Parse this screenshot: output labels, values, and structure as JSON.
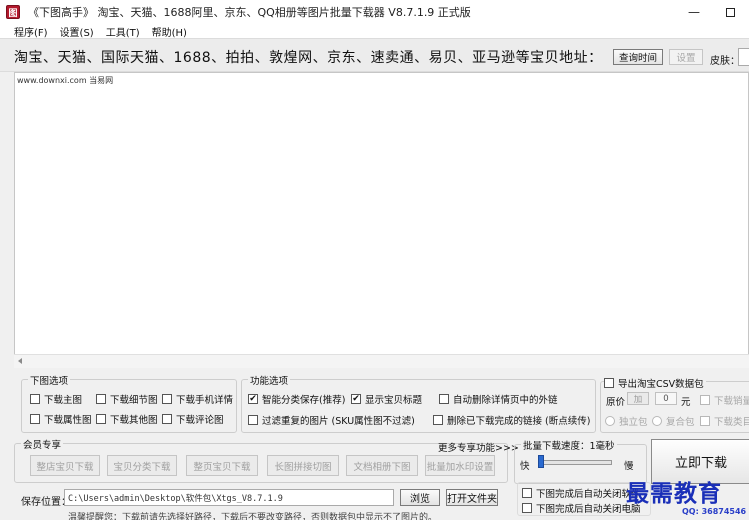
{
  "window": {
    "icon_glyph": "图",
    "title": "《下图高手》 淘宝、天猫、1688阿里、京东、QQ相册等图片批量下载器 V8.7.1.9 正式版",
    "min_glyph": "—",
    "icon": "app-logo-icon"
  },
  "menu": [
    "程序(F)",
    "设置(S)",
    "工具(T)",
    "帮助(H)"
  ],
  "url_bar": {
    "label": "淘宝、天猫、国际天猫、1688、拍拍、敦煌网、京东、速卖通、易贝、亚马逊等宝贝地址：",
    "query_time_button": "查询时间",
    "settings_button": "设置",
    "skin_label": "皮肤："
  },
  "text_area": {
    "content": "www.downxi.com 当易网"
  },
  "download_options": {
    "title": "下图选项",
    "items": [
      {
        "label": "下载主图",
        "checked": false
      },
      {
        "label": "下载细节图",
        "checked": false
      },
      {
        "label": "下载手机详情",
        "checked": false
      },
      {
        "label": "下载属性图",
        "checked": false
      },
      {
        "label": "下载其他图",
        "checked": false
      },
      {
        "label": "下载评论图",
        "checked": false
      }
    ]
  },
  "function_options": {
    "title": "功能选项",
    "items": [
      {
        "label": "智能分类保存(推荐)",
        "checked": true
      },
      {
        "label": "显示宝贝标题",
        "checked": true
      },
      {
        "label": "自动删除详情页中的外链",
        "checked": false
      },
      {
        "label": "过滤重复的图片 (SKU属性图不过滤)",
        "checked": false
      },
      {
        "label": "删除已下载完成的链接 (断点续传)",
        "checked": false
      }
    ]
  },
  "csv_export": {
    "title": "导出淘宝CSV数据包",
    "price_label": "原价",
    "price_op": "加",
    "price_value": "0",
    "price_unit": "元",
    "download_sales": "下载销量",
    "radio_independent": "独立包",
    "radio_merged": "复合包",
    "download_category": "下载类目"
  },
  "member": {
    "title": "会员专享",
    "more_link": "更多专享功能>>>",
    "buttons": [
      "整店宝贝下载",
      "宝贝分类下载",
      "整页宝贝下载",
      "长图拼接切图",
      "文档相册下图",
      "批量加水印设置"
    ]
  },
  "batch": {
    "speed_label": "批量下载速度：1毫秒",
    "fast": "快",
    "slow": "慢",
    "close_app_after": "下图完成后自动关闭软件",
    "shutdown_after": "下图完成后自动关闭电脑"
  },
  "download_button": "立即下载",
  "save": {
    "label": "保存位置：",
    "path": "C:\\Users\\admin\\Desktop\\软件包\\Xtgs_V8.7.1.9",
    "browse_button": "浏览",
    "open_folder_button": "打开文件夹",
    "tip": "温馨提醒您：下载前请先选择好路径，下载后不要改变路径，否则数据包中显示不了图片的。"
  },
  "watermark": {
    "text": "最需教育",
    "qq": "QQ: 36874546"
  }
}
